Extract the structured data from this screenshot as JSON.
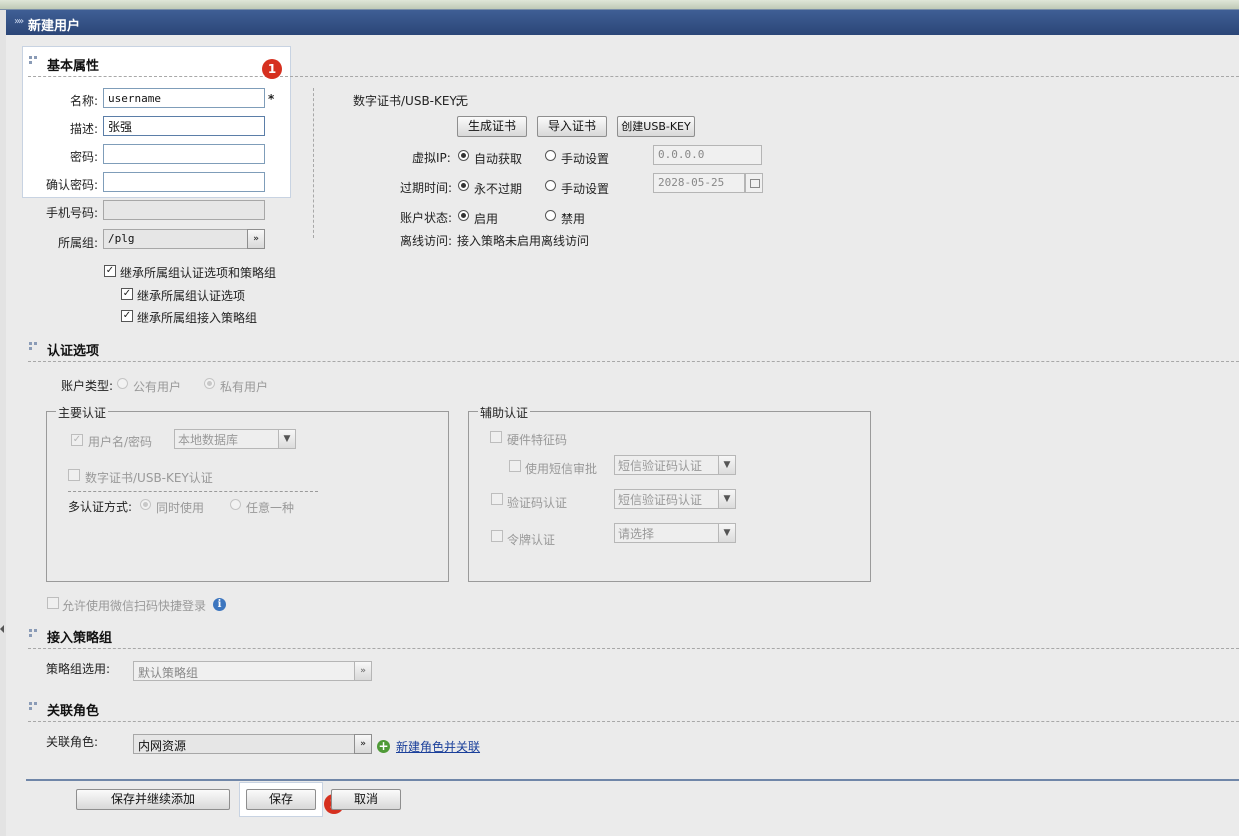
{
  "window": {
    "title": "新建用户"
  },
  "basic": {
    "section_title": "基本属性",
    "name_label": "名称:",
    "name_value": "username",
    "required_mark": "*",
    "desc_label": "描述:",
    "desc_value": "张强",
    "password_label": "密码:",
    "confirm_label": "确认密码:",
    "phone_label": "手机号码:",
    "group_label": "所属组:",
    "group_value": "/plg",
    "inherit_all": "继承所属组认证选项和策略组",
    "inherit_auth": "继承所属组认证选项",
    "inherit_policy": "继承所属组接入策略组"
  },
  "cert": {
    "label": "数字证书/USB-KEY:",
    "value": "无",
    "gen_button": "生成证书",
    "import_button": "导入证书",
    "create_button": "创建USB-KEY",
    "vip_label": "虚拟IP:",
    "vip_auto": "自动获取",
    "vip_manual": "手动设置",
    "vip_value": "0.0.0.0",
    "expire_label": "过期时间:",
    "expire_never": "永不过期",
    "expire_manual": "手动设置",
    "expire_value": "2028-05-25",
    "status_label": "账户状态:",
    "status_enabled": "启用",
    "status_disabled": "禁用",
    "offline_label": "离线访问:",
    "offline_value": "接入策略未启用离线访问"
  },
  "auth": {
    "section_title": "认证选项",
    "account_type_label": "账户类型:",
    "public_user": "公有用户",
    "private_user": "私有用户",
    "primary": {
      "legend": "主要认证",
      "userpass": "用户名/密码",
      "userpass_source": "本地数据库",
      "cert": "数字证书/USB-KEY认证",
      "multi_label": "多认证方式:",
      "multi_both": "同时使用",
      "multi_any": "任意一种"
    },
    "secondary": {
      "legend": "辅助认证",
      "hardware": "硬件特征码",
      "sms_approve": "使用短信审批",
      "sms_approve_select": "短信验证码认证",
      "captcha": "验证码认证",
      "captcha_select": "短信验证码认证",
      "token": "令牌认证",
      "token_select": "请选择"
    },
    "wechat": "允许使用微信扫码快捷登录"
  },
  "policy": {
    "section_title": "接入策略组",
    "label": "策略组选用:",
    "value": "默认策略组"
  },
  "role": {
    "section_title": "关联角色",
    "label": "关联角色:",
    "value": "内网资源",
    "new_link": "新建角色并关联"
  },
  "footer": {
    "save_continue": "保存并继续添加",
    "save": "保存",
    "cancel": "取消"
  },
  "badges": {
    "one": "1",
    "two": "2"
  },
  "colors": {
    "titlebar": "#2f4c80",
    "badge": "#d6301f",
    "link": "#1a3f9a"
  }
}
